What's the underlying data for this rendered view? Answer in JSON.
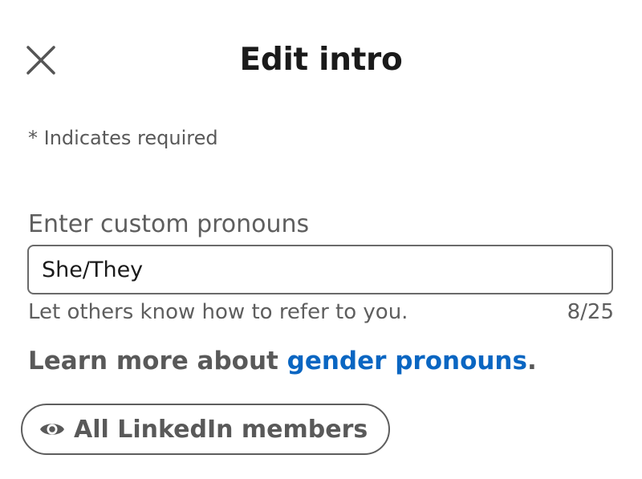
{
  "header": {
    "title": "Edit intro",
    "close_icon": "close-icon"
  },
  "form": {
    "required_note": "* Indicates required",
    "pronouns_field": {
      "label": "Enter custom pronouns",
      "value": "She/They",
      "helper_text": "Let others know how to refer to you.",
      "char_count": "8/25"
    },
    "learn_more": {
      "prefix": "Learn more about ",
      "link_text": "gender pronouns",
      "suffix": "."
    },
    "visibility": {
      "icon": "eye-icon",
      "label": "All LinkedIn members"
    }
  },
  "colors": {
    "link": "#0a66c2",
    "text_primary": "#1a1a1a",
    "text_secondary": "#5e5e5e",
    "border": "#6a6a6a"
  }
}
